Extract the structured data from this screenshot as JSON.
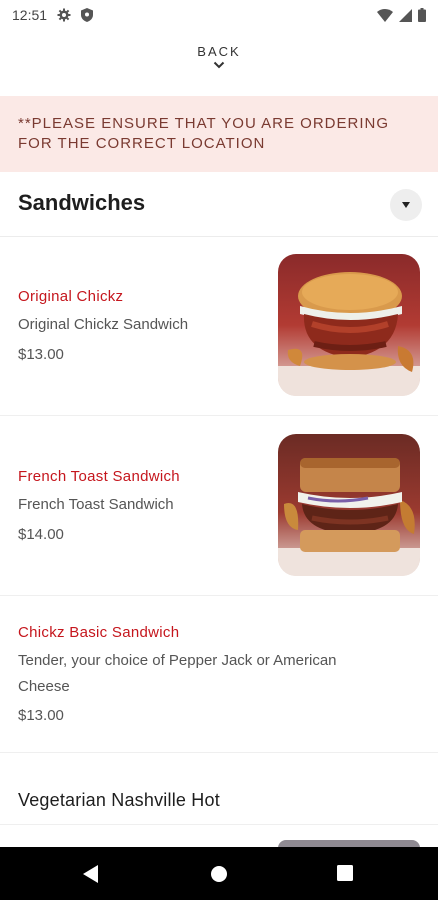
{
  "status": {
    "time": "12:51"
  },
  "header": {
    "back_label": "BACK"
  },
  "notice": {
    "line1": "**PLEASE ENSURE THAT YOU ARE ORDERING",
    "line2": "FOR THE CORRECT LOCATION"
  },
  "section": {
    "title": "Sandwiches"
  },
  "items": [
    {
      "name": "Original Chickz",
      "description": "Original Chickz Sandwich",
      "price": "$13.00"
    },
    {
      "name": "French Toast Sandwich",
      "description": "French Toast Sandwich",
      "price": "$14.00"
    },
    {
      "name": "Chickz Basic Sandwich",
      "description_line1": "Tender, your choice of Pepper Jack or American",
      "description_line2": "Cheese",
      "price": "$13.00"
    }
  ],
  "next_item": {
    "name": "Vegetarian Nashville Hot"
  },
  "colors": {
    "accent": "#c5161d",
    "notice_bg": "#fbe9e6",
    "notice_text": "#7a3a31"
  }
}
